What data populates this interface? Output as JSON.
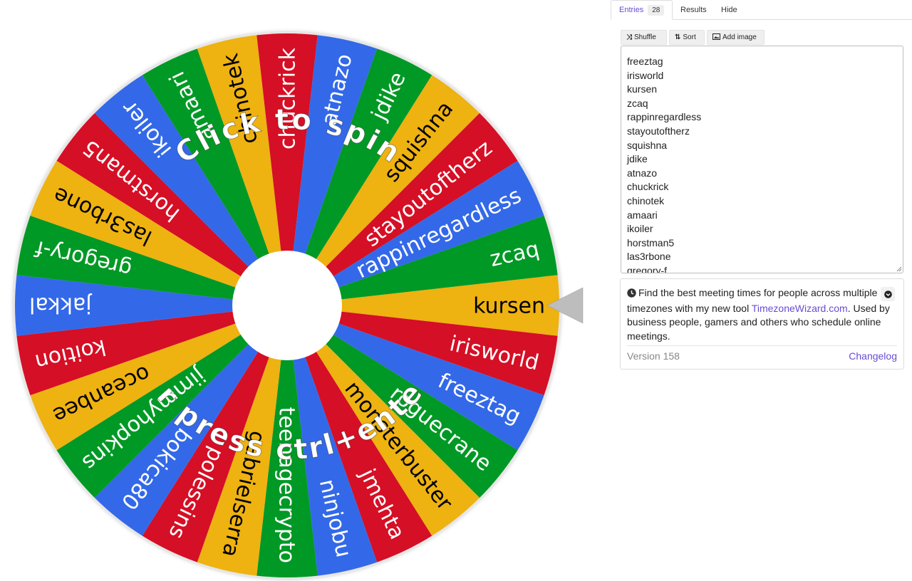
{
  "wheel": {
    "segments": [
      "kursen",
      "irisworld",
      "freeztag",
      "roguecrane",
      "monsterbuster",
      "jmehta",
      "ninjobu",
      "teenagecrypto",
      "gabrielserra",
      "polessins",
      "bokica80",
      "jimmyhopkins",
      "oceanbee",
      "koition",
      "jakkal",
      "gregory-f",
      "las3rbone",
      "horstman5",
      "ikoiler",
      "amaari",
      "chinotek",
      "chuckrick",
      "atnazo",
      "jdike",
      "squishna",
      "stayoutoftherz",
      "rappinregardless",
      "zcaq"
    ],
    "colors": [
      "#eeb211",
      "#d50f25",
      "#3369e8",
      "#009925"
    ],
    "prompt_top": "Click to spin",
    "prompt_bottom": "or press ctrl+enter"
  },
  "tabs": {
    "entries_label": "Entries",
    "entries_count": "28",
    "results_label": "Results",
    "hide_label": "Hide"
  },
  "toolbar": {
    "shuffle_label": "Shuffle",
    "sort_label": "Sort",
    "add_image_label": "Add image"
  },
  "entries": [
    "freeztag",
    "irisworld",
    "kursen",
    "zcaq",
    "rappinregardless",
    "stayoutoftherz",
    "squishna",
    "jdike",
    "atnazo",
    "chuckrick",
    "chinotek",
    "amaari",
    "ikoiler",
    "horstman5",
    "las3rbone",
    "gregory-f"
  ],
  "info": {
    "text_before": "Find the best meeting times for people across multiple timezones with my new tool ",
    "link_text": "TimezoneWizard.com",
    "text_after": ". Used by business people, gamers and others who schedule online meetings.",
    "version": "Version 158",
    "changelog": "Changelog"
  }
}
